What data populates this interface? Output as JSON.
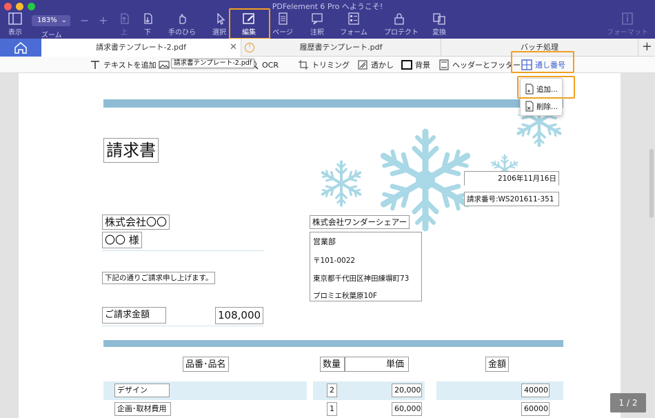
{
  "window": {
    "title": "PDFelement 6 Pro へようこそ!"
  },
  "toolbar": {
    "zoom_value": "183%",
    "items": [
      {
        "label": "表示",
        "icon": "sidebar-icon"
      },
      {
        "label": "ズーム",
        "icon": "zoom-icon"
      },
      {
        "label": "上",
        "icon": "page-up-icon"
      },
      {
        "label": "下",
        "icon": "page-down-icon"
      },
      {
        "label": "手のひら",
        "icon": "hand-icon"
      },
      {
        "label": "選択",
        "icon": "cursor-icon"
      },
      {
        "label": "編集",
        "icon": "edit-icon"
      },
      {
        "label": "ページ",
        "icon": "page-icon"
      },
      {
        "label": "注釈",
        "icon": "comment-icon"
      },
      {
        "label": "フォーム",
        "icon": "form-icon"
      },
      {
        "label": "プロテクト",
        "icon": "lock-icon"
      },
      {
        "label": "変換",
        "icon": "convert-icon"
      },
      {
        "label": "フォーマット",
        "icon": "format-icon"
      }
    ]
  },
  "tabs": {
    "items": [
      {
        "label": "請求書テンプレート-2.pdf"
      },
      {
        "label": "履歴書テンプレート.pdf"
      },
      {
        "label": "バッチ処理"
      }
    ]
  },
  "editbar": {
    "items": [
      {
        "label": "テキストを追加",
        "icon": "text-add-icon"
      },
      {
        "label": "OCR",
        "icon": "ocr-icon"
      },
      {
        "label": "トリミング",
        "icon": "crop-icon"
      },
      {
        "label": "透かし",
        "icon": "watermark-icon"
      },
      {
        "label": "背景",
        "icon": "background-icon"
      },
      {
        "label": "ヘッダーとフッター",
        "icon": "header-footer-icon"
      },
      {
        "label": "通し番号",
        "icon": "bates-number-icon"
      }
    ],
    "tooltip": "請求書テンプレート-2.pdf"
  },
  "dropdown": {
    "items": [
      {
        "label": "追加..."
      },
      {
        "label": "削除..."
      }
    ]
  },
  "document": {
    "title": "請求書",
    "date": "2106年11月16日",
    "invoice_no": "請求番号:WS201611-351",
    "client_company": "株式会社〇〇",
    "client_name": "〇〇 様",
    "request_text": "下記の通りご請求申し上げます。",
    "amount_label": "ご請求金額",
    "amount_value": "108,000",
    "issuer_company": "株式会社ワンダーシェアー",
    "issuer_dept": "営業部",
    "issuer_zip": "〒101-0022",
    "issuer_address": "東京都千代田区神田練塀町73",
    "issuer_building": "プロミエ秋葉原10F",
    "table_headers": [
      "品番･品名",
      "数量",
      "単価",
      "金額"
    ],
    "rows": [
      {
        "name": "デザイン",
        "qty": "2",
        "price": "20,000",
        "amount": "40000"
      },
      {
        "name": "企画･取材費用",
        "qty": "1",
        "price": "60,000",
        "amount": "60000"
      }
    ]
  },
  "page_indicator": "1 / 2",
  "colors": {
    "toolbar_bg": "#3d3b8e",
    "highlight": "#f0a020",
    "accent_blue": "#4a6cd4",
    "band": "#8fbcd4",
    "snowflake": "#a9d8e6"
  }
}
